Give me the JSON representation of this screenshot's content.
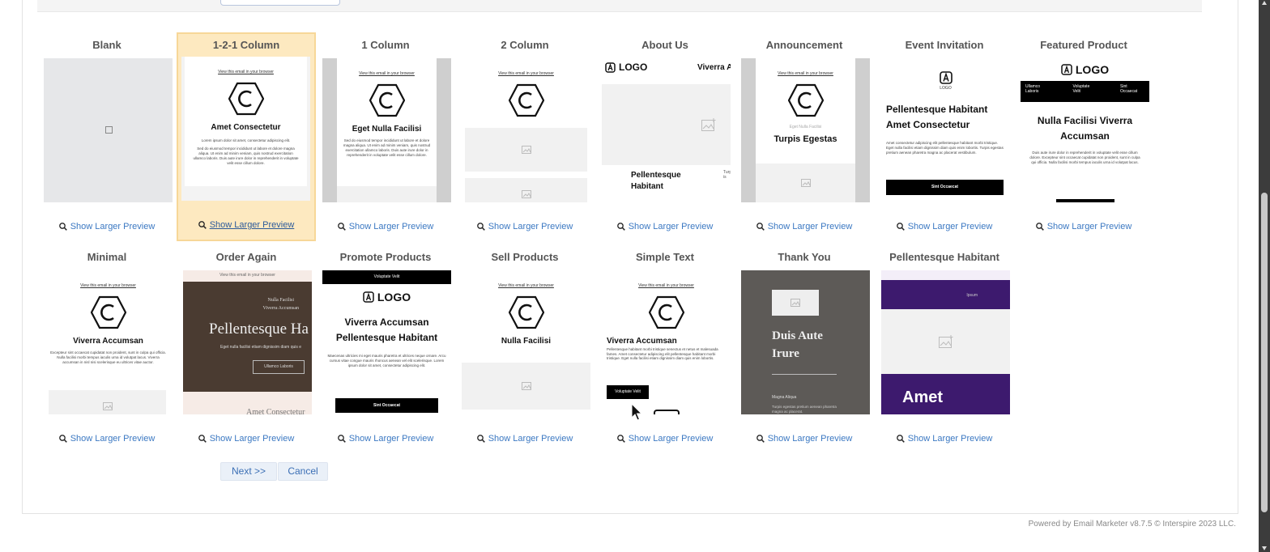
{
  "templates_row1": [
    {
      "title": "Blank",
      "preview": "Show Larger Preview"
    },
    {
      "title": "1-2-1 Column",
      "preview": "Show Larger Preview"
    },
    {
      "title": "1 Column",
      "preview": "Show Larger Preview"
    },
    {
      "title": "2 Column",
      "preview": "Show Larger Preview"
    },
    {
      "title": "About Us",
      "preview": "Show Larger Preview"
    },
    {
      "title": "Announcement",
      "preview": "Show Larger Preview"
    },
    {
      "title": "Event Invitation",
      "preview": "Show Larger Preview"
    },
    {
      "title": "Featured Product",
      "preview": "Show Larger Preview"
    }
  ],
  "templates_row2": [
    {
      "title": "Minimal",
      "preview": "Show Larger Preview"
    },
    {
      "title": "Order Again",
      "preview": "Show Larger Preview"
    },
    {
      "title": "Promote Products",
      "preview": "Show Larger Preview"
    },
    {
      "title": "Sell Products",
      "preview": "Show Larger Preview"
    },
    {
      "title": "Simple Text",
      "preview": "Show Larger Preview"
    },
    {
      "title": "Thank You",
      "preview": "Show Larger Preview"
    },
    {
      "title": "Pellentesque Habitant",
      "preview": "Show Larger Preview"
    }
  ],
  "thumb": {
    "view_link": "View this email in your browser",
    "logo": "LOGO",
    "t121_heading": "Amet Consectetur",
    "t121_intro": "Lorem ipsum dolor sit amet, consectetur adipiscing elit.",
    "t121_body": "Sed do eiusmod tempor incididunt ut labore et dolore magna aliqua. Ut enim ad minim veniam, quis nostrud exercitation ullamco laboris. Duis aute irure dolor in reprehenderit in voluptate velit esse cillum dolore.",
    "t1col_heading": "Eget Nulla Facilisi",
    "t1col_body": "Sed do eiusmod tempor incididunt ut labore et dolore magna aliqua. Ut enim ad minim veniam, quis nostrud exercitation ullamco laboris. Duis aute irure dolor in reprehenderit in voluptate velit esse cillum dolore.",
    "about_nav": "Viverra A",
    "about_heading": "Pellentesque Habitant",
    "about_side": "Turp is",
    "announce_sub": "Eget Nulla Facilisi",
    "announce_heading": "Turpis Egestas",
    "event_heading": "Pellentesque Habitant Amet Consectetur",
    "event_body": "Amet consectetur adipiscing elit pellentesque habitant morbi tristique. Eget nulla facilisi etiam dignissim diam quis enim lobortis. Turpis egestas pretium aenean pharetra magna ac placerat vestibulum.",
    "event_button": "Sint Occaecat",
    "fp_nav": [
      "Ullamco Laboris",
      "Voluptate Velit",
      "Sint Occaecat"
    ],
    "fp_heading": "Nulla Facilisi Viverra Accumsan",
    "fp_body": "Duis aute irure dolor in reprehenderit in voluptate velit esse cillum dolore. Excepteur sint occaecat cupidatat non proident, sunt in culpa qui officia. Nulla facilisi morbi tempus iaculis urna id volutpat lacus.",
    "minimal_heading": "Viverra Accumsan",
    "minimal_body": "Excepteur sint occaecat cupidatat non proident, sunt in culpa qui officia. Nulla facilisi morbi tempus iaculis urna id volutpat lacus. Viverra accumsan in nisl nisi scelerisque eu ultrices vitae auctor.",
    "oa_top1": "Nulla Facilisi",
    "oa_top2": "Viverra Accumsan",
    "oa_heading": "Pellentesque Ha",
    "oa_body": "Eget nulla facilisi etiam dignissim diam quis e",
    "oa_button": "Ullamco Laboris",
    "oa_bottom": "Amet Consectetur",
    "pp_bar": "Voluptate Velit",
    "pp_heading": "Viverra Accumsan Pellentesque Habitant",
    "pp_body": "Maecenas ultricies mi eget mauris pharetra et ultrices neque ornare. Arcu cursus vitae congue mauris rhoncus aenean vel elit scelerisque. Lorem ipsum dolor sit amet, consectetur adipiscing elit.",
    "pp_button": "Sint Occaecat",
    "sell_heading": "Nulla Facilisi",
    "st_heading": "Viverra Accumsan",
    "st_body": "Pellentesque habitant morbi tristique senectus et netus et malesuada fames. Amet consectetur adipiscing elit pellentesque habitant morbi tristique. Eget nulla facilisi etiam dignissim diam quis enim lobortis.",
    "st_button": "Voluptate Velit",
    "ty_heading": "Duis Aute Irure",
    "ty_sub": "Magna Aliqua",
    "ty_body": "Turpis egestas pretium aenean pharetra magna ac placerat.",
    "ph_bar": "Ipsum",
    "ph_heading": "Amet"
  },
  "buttons": {
    "next": "Next >>",
    "cancel": "Cancel"
  },
  "footer": "Powered by Email Marketer v8.7.5 © Interspire 2023 LLC.",
  "colors": {
    "link": "#3b78c2",
    "selected_bg": "#fde9c0",
    "order_again_bg": "#4a3b31",
    "thank_you_bg": "#5d5a57",
    "purple": "#3d1a6e"
  }
}
